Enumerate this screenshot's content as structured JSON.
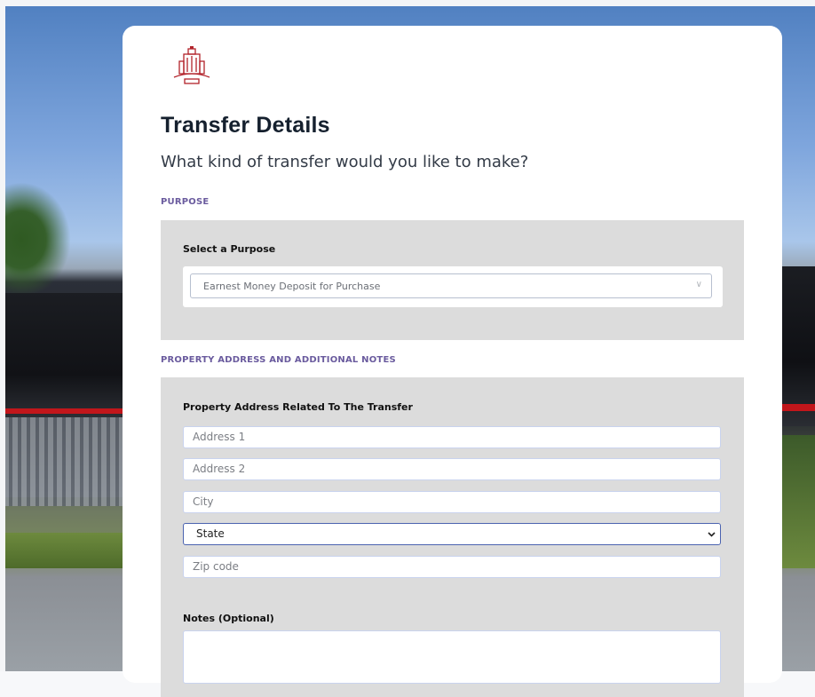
{
  "header": {
    "title": "Transfer Details",
    "subtitle": "What kind of transfer would you like to make?"
  },
  "purpose_section": {
    "label": "PURPOSE",
    "field_label": "Select a Purpose",
    "selected_value": "Earnest Money Deposit for Purchase",
    "chevron": "∨"
  },
  "address_section": {
    "label": "PROPERTY ADDRESS AND ADDITIONAL NOTES",
    "field_label": "Property Address Related To The Transfer",
    "address1_placeholder": "Address 1",
    "address2_placeholder": "Address 2",
    "city_placeholder": "City",
    "state_value": "State",
    "zip_placeholder": "Zip code",
    "notes_label": "Notes (Optional)"
  },
  "colors": {
    "section_label": "#6a5b9e",
    "panel_bg": "#dcdcdc",
    "title": "#15202e",
    "focus_border": "#4b63b0",
    "logo_red": "#b2222a"
  },
  "icons": {
    "logo": "building-logo-icon",
    "select_arrow": "chevron-down-icon"
  }
}
